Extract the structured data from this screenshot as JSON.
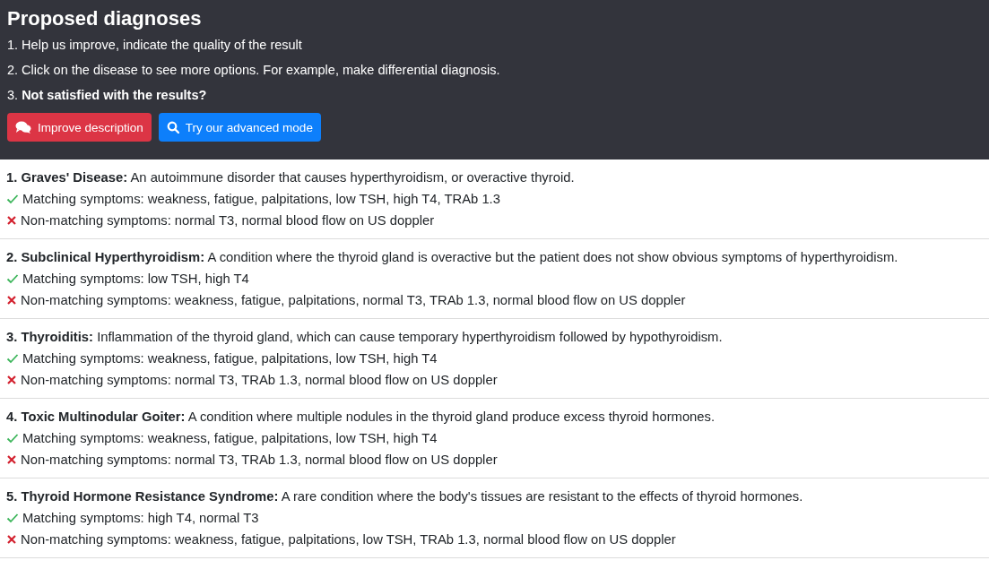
{
  "header": {
    "title": "Proposed diagnoses",
    "instructions": [
      "1. Help us improve, indicate the quality of the result",
      "2. Click on the disease to see more options. For example, make differential diagnosis.",
      "3. **Not satisfied with the results?**"
    ],
    "buttons": [
      {
        "label": "Improve description",
        "kind": "improve"
      },
      {
        "label": "Try our advanced mode",
        "kind": "advanced"
      }
    ]
  },
  "diagnoses": [
    {
      "text": "**1. Graves' Disease:** An autoimmune disorder that causes hyperthyroidism, or overactive thyroid.",
      "symptoms": [
        {
          "kind": "match",
          "text": "Matching symptoms: weakness, fatigue, palpitations, low TSH, high T4, TRAb 1.3"
        },
        {
          "kind": "nonmatch",
          "text": "Non-matching symptoms: normal T3, normal blood flow on US doppler"
        }
      ]
    },
    {
      "text": "**2. Subclinical Hyperthyroidism:** A condition where the thyroid gland is overactive but the patient does not show obvious symptoms of hyperthyroidism.",
      "symptoms": [
        {
          "kind": "match",
          "text": "Matching symptoms: low TSH, high T4"
        },
        {
          "kind": "nonmatch",
          "text": "Non-matching symptoms: weakness, fatigue, palpitations, normal T3, TRAb 1.3, normal blood flow on US doppler"
        }
      ]
    },
    {
      "text": "**3. Thyroiditis:** Inflammation of the thyroid gland, which can cause temporary hyperthyroidism followed by hypothyroidism.",
      "symptoms": [
        {
          "kind": "match",
          "text": "Matching symptoms: weakness, fatigue, palpitations, low TSH, high T4"
        },
        {
          "kind": "nonmatch",
          "text": "Non-matching symptoms: normal T3, TRAb 1.3, normal blood flow on US doppler"
        }
      ]
    },
    {
      "text": "**4. Toxic Multinodular Goiter:** A condition where multiple nodules in the thyroid gland produce excess thyroid hormones.",
      "symptoms": [
        {
          "kind": "match",
          "text": "Matching symptoms: weakness, fatigue, palpitations, low TSH, high T4"
        },
        {
          "kind": "nonmatch",
          "text": "Non-matching symptoms: normal T3, TRAb 1.3, normal blood flow on US doppler"
        }
      ]
    },
    {
      "text": "**5. Thyroid Hormone Resistance Syndrome:** A rare condition where the body's tissues are resistant to the effects of thyroid hormones.",
      "symptoms": [
        {
          "kind": "match",
          "text": "Matching symptoms: high T4, normal T3"
        },
        {
          "kind": "nonmatch",
          "text": "Non-matching symptoms: weakness, fatigue, palpitations, low TSH, TRAb 1.3, normal blood flow on US doppler"
        }
      ]
    }
  ]
}
